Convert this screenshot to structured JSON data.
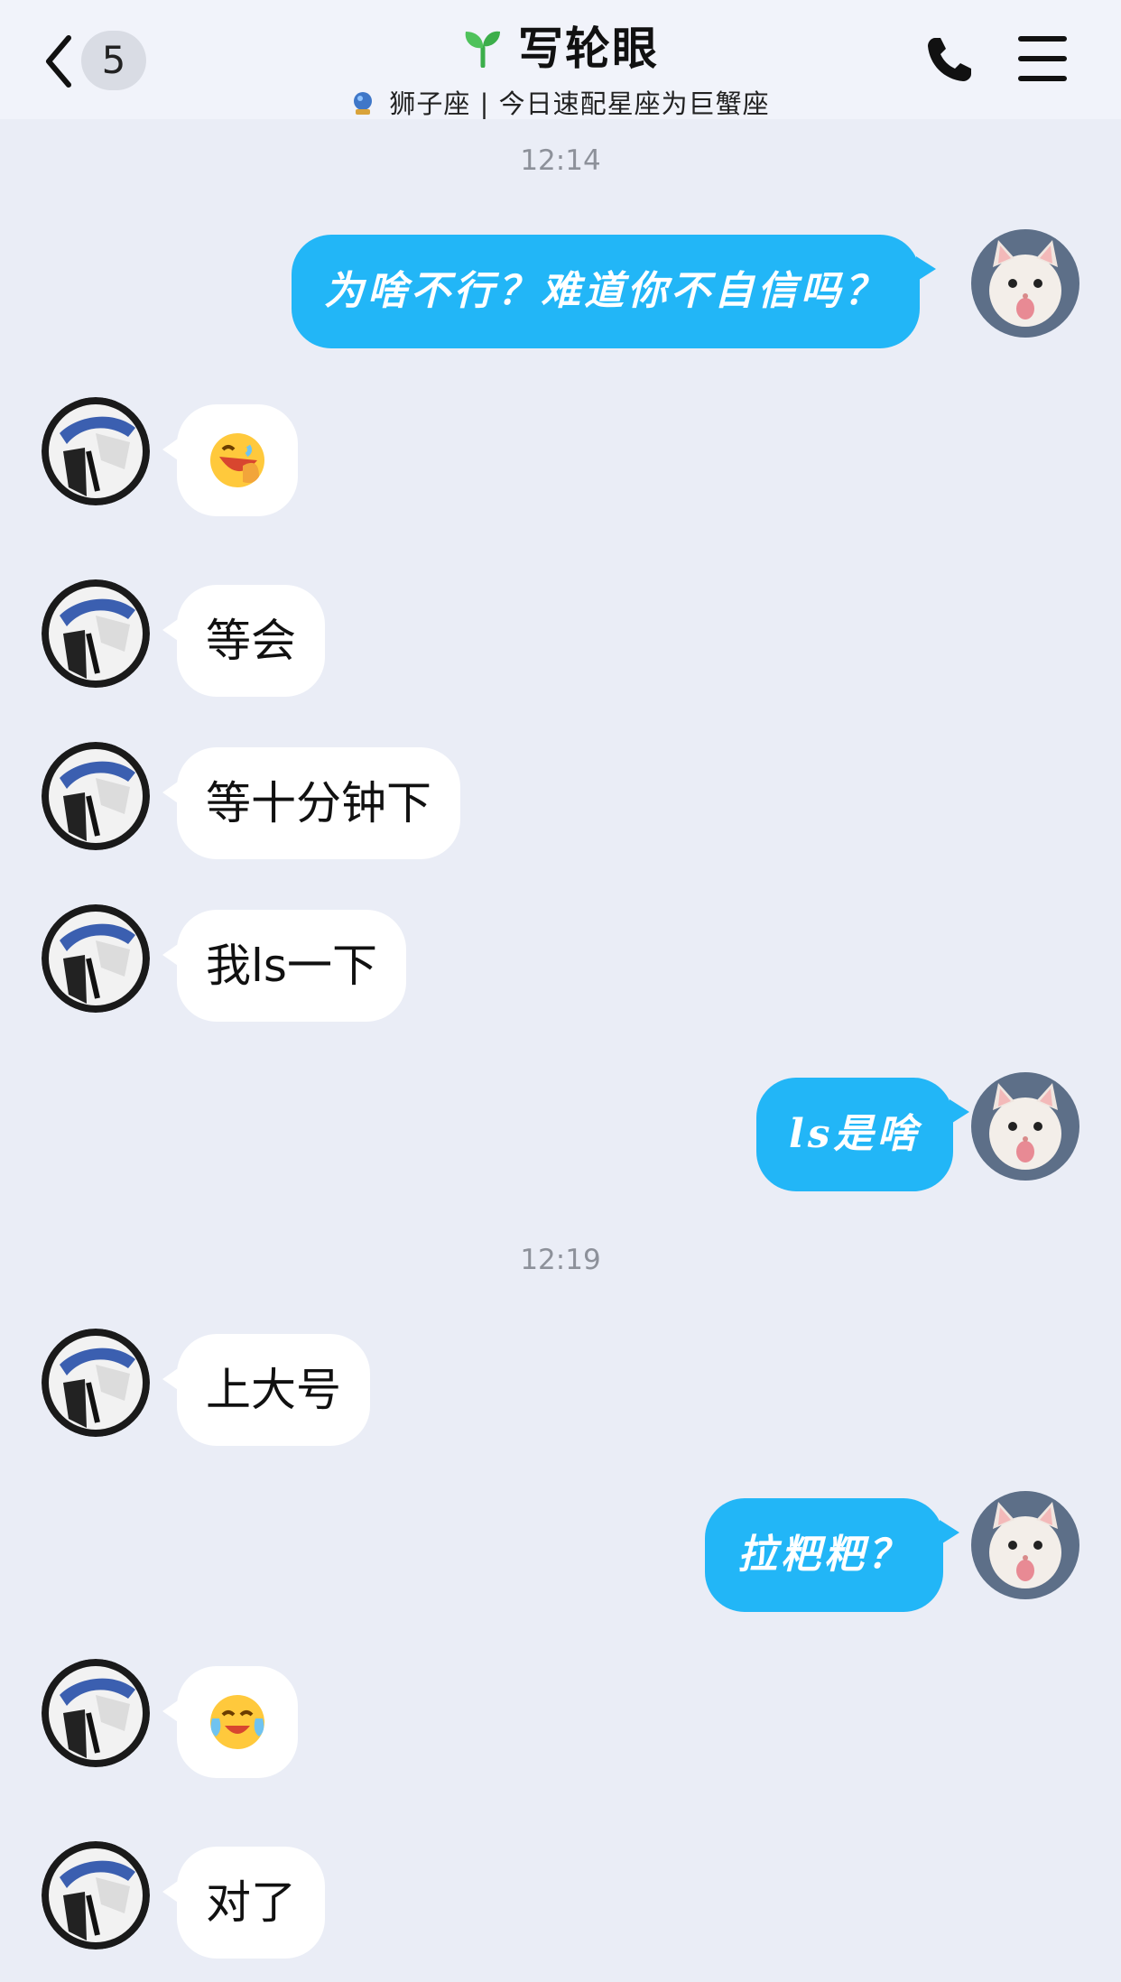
{
  "header": {
    "back_count": "5",
    "contact_name": "写轮眼",
    "subtitle": "狮子座 | 今日速配星座为巨蟹座"
  },
  "timestamps": [
    "12:14",
    "12:19"
  ],
  "messages": [
    {
      "side": "out",
      "text": "为啥不行？难道你不自信吗？"
    },
    {
      "side": "in",
      "emoji": "face-palm-laughing-emoji"
    },
    {
      "side": "in",
      "text": "等会"
    },
    {
      "side": "in",
      "text": "等十分钟下"
    },
    {
      "side": "in",
      "text": "我ls一下"
    },
    {
      "side": "out",
      "text": "ls是啥"
    },
    {
      "side": "out",
      "text": "拉粑粑？"
    },
    {
      "side": "in",
      "text": "上大号"
    },
    {
      "side": "in",
      "emoji": "crying-laughing-emoji"
    },
    {
      "side": "in",
      "text": "对了"
    }
  ],
  "colors": {
    "background": "#eaedf6",
    "header": "#f1f3fa",
    "outgoing_bubble": "#22b6f7",
    "incoming_bubble": "#ffffff",
    "timestamp": "#8d919a"
  }
}
